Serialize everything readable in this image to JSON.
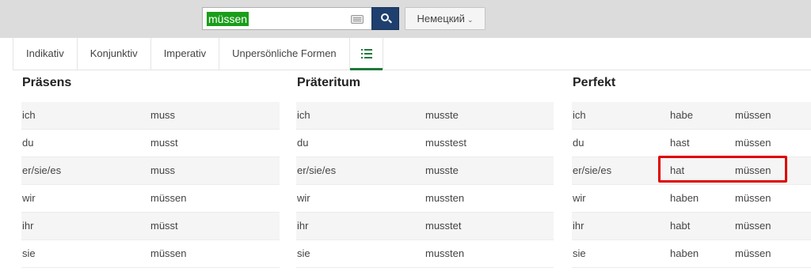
{
  "search": {
    "value": "müssen"
  },
  "language": {
    "label": "Немецкий"
  },
  "icons": {
    "keyboard": "keyboard-icon",
    "search": "search-icon",
    "chevron": "chevron-down-icon",
    "list": "list-icon"
  },
  "colors": {
    "accent": "#1e7a3a",
    "search_button": "#1f3f6e",
    "highlight": "#e00000",
    "selection": "#1a9e1a"
  },
  "tabs": [
    {
      "label": "Indikativ"
    },
    {
      "label": "Konjunktiv"
    },
    {
      "label": "Imperativ"
    },
    {
      "label": "Unpersönliche Formen"
    }
  ],
  "praesens": {
    "title": "Präsens",
    "rows": [
      {
        "pronoun": "ich",
        "form": "muss"
      },
      {
        "pronoun": "du",
        "form": "musst"
      },
      {
        "pronoun": "er/sie/es",
        "form": "muss"
      },
      {
        "pronoun": "wir",
        "form": "müssen"
      },
      {
        "pronoun": "ihr",
        "form": "müsst"
      },
      {
        "pronoun": "sie",
        "form": "müssen"
      }
    ]
  },
  "praeteritum": {
    "title": "Präteritum",
    "rows": [
      {
        "pronoun": "ich",
        "form": "musste"
      },
      {
        "pronoun": "du",
        "form": "musstest"
      },
      {
        "pronoun": "er/sie/es",
        "form": "musste"
      },
      {
        "pronoun": "wir",
        "form": "mussten"
      },
      {
        "pronoun": "ihr",
        "form": "musstet"
      },
      {
        "pronoun": "sie",
        "form": "mussten"
      }
    ]
  },
  "perfekt": {
    "title": "Perfekt",
    "rows": [
      {
        "pronoun": "ich",
        "aux": "habe",
        "participle": "müssen"
      },
      {
        "pronoun": "du",
        "aux": "hast",
        "participle": "müssen"
      },
      {
        "pronoun": "er/sie/es",
        "aux": "hat",
        "participle": "müssen"
      },
      {
        "pronoun": "wir",
        "aux": "haben",
        "participle": "müssen"
      },
      {
        "pronoun": "ihr",
        "aux": "habt",
        "participle": "müssen"
      },
      {
        "pronoun": "sie",
        "aux": "haben",
        "participle": "müssen"
      }
    ]
  }
}
